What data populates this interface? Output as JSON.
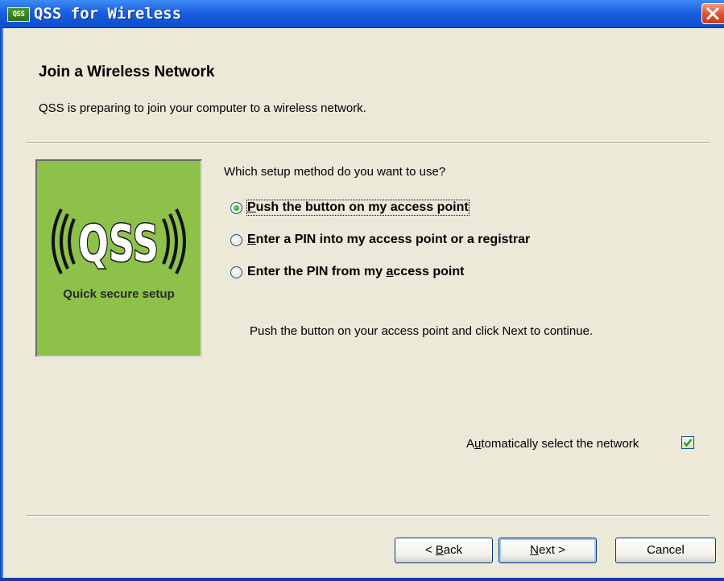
{
  "window": {
    "icon_text": "QSS",
    "title": "QSS for Wireless"
  },
  "header": {
    "title": "Join a Wireless Network",
    "subtitle": "QSS is preparing to join your computer to a wireless network."
  },
  "logo": {
    "text": "QSS",
    "tagline": "Quick secure setup",
    "background": "#8dc14a"
  },
  "question": "Which setup method do you want to use?",
  "options": [
    {
      "pre": "",
      "ul": "P",
      "post": "ush the button on my access point",
      "checked": true
    },
    {
      "pre": "",
      "ul": "E",
      "post": "nter a PIN into my access point or a registrar",
      "checked": false
    },
    {
      "pre": "Enter the PIN from my ",
      "ul": "a",
      "post": "ccess point",
      "checked": false
    }
  ],
  "instruction": "Push the button on your access point and click Next to continue.",
  "auto_select": {
    "pre": "A",
    "ul": "u",
    "post": "tomatically select the network",
    "checked": true
  },
  "buttons": {
    "back": {
      "pre": "< ",
      "ul": "B",
      "post": "ack"
    },
    "next": {
      "pre": "",
      "ul": "N",
      "post": "ext >"
    },
    "cancel": {
      "label": "Cancel"
    }
  },
  "colors": {
    "dialog_bg": "#ece9d8",
    "titlebar": "#0a4ecf",
    "close": "#e0502a"
  }
}
